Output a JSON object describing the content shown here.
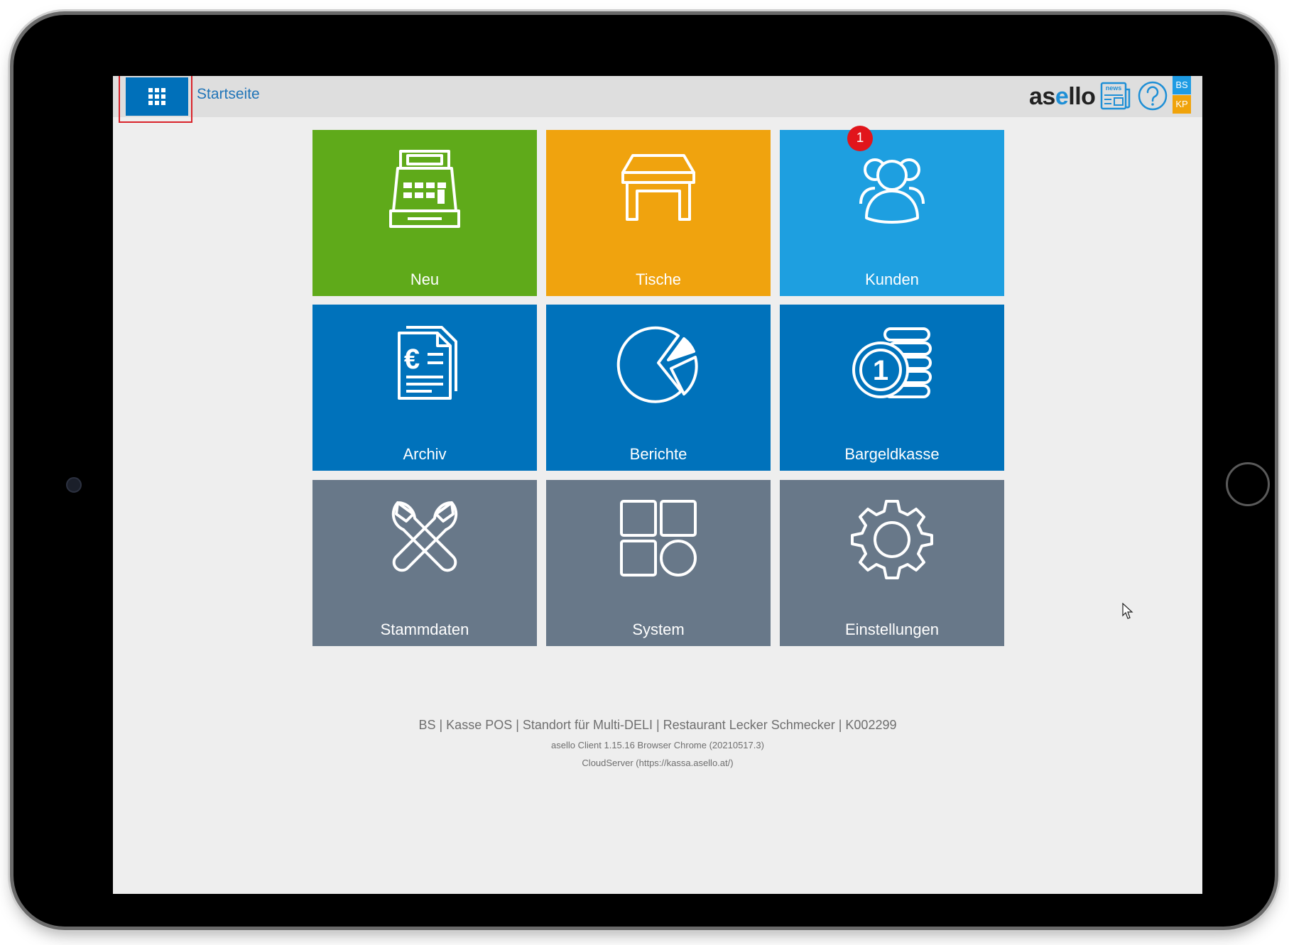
{
  "header": {
    "breadcrumb": "Startseite",
    "brand_prefix": "as",
    "brand_accent": "e",
    "brand_suffix": "llo",
    "user_badge": "BS",
    "register_badge": "KP",
    "icons": [
      "apps-grid-icon",
      "news-icon",
      "help-icon"
    ]
  },
  "tiles": [
    {
      "label": "Neu",
      "icon": "cash-register-icon",
      "color": "#5faa1a"
    },
    {
      "label": "Tische",
      "icon": "table-icon",
      "color": "#f0a30e",
      "badge": "1"
    },
    {
      "label": "Kunden",
      "icon": "customers-icon",
      "color": "#1e9fe0"
    },
    {
      "label": "Archiv",
      "icon": "invoice-archive-icon",
      "color": "#0072bb"
    },
    {
      "label": "Berichte",
      "icon": "pie-chart-icon",
      "color": "#0072bb"
    },
    {
      "label": "Bargeldkasse",
      "icon": "coins-icon",
      "color": "#0072bb"
    },
    {
      "label": "Stammdaten",
      "icon": "tools-icon",
      "color": "#687889"
    },
    {
      "label": "System",
      "icon": "system-grid-icon",
      "color": "#687889"
    },
    {
      "label": "Einstellungen",
      "icon": "gear-icon",
      "color": "#687889"
    }
  ],
  "footer": {
    "info_line": "BS | Kasse POS | Standort für Multi-DELI | Restaurant Lecker Schmecker | K002299",
    "version_line": "asello Client 1.15.16 Browser Chrome (20210517.3)",
    "server_line": "CloudServer (https://kassa.asello.at/)"
  }
}
